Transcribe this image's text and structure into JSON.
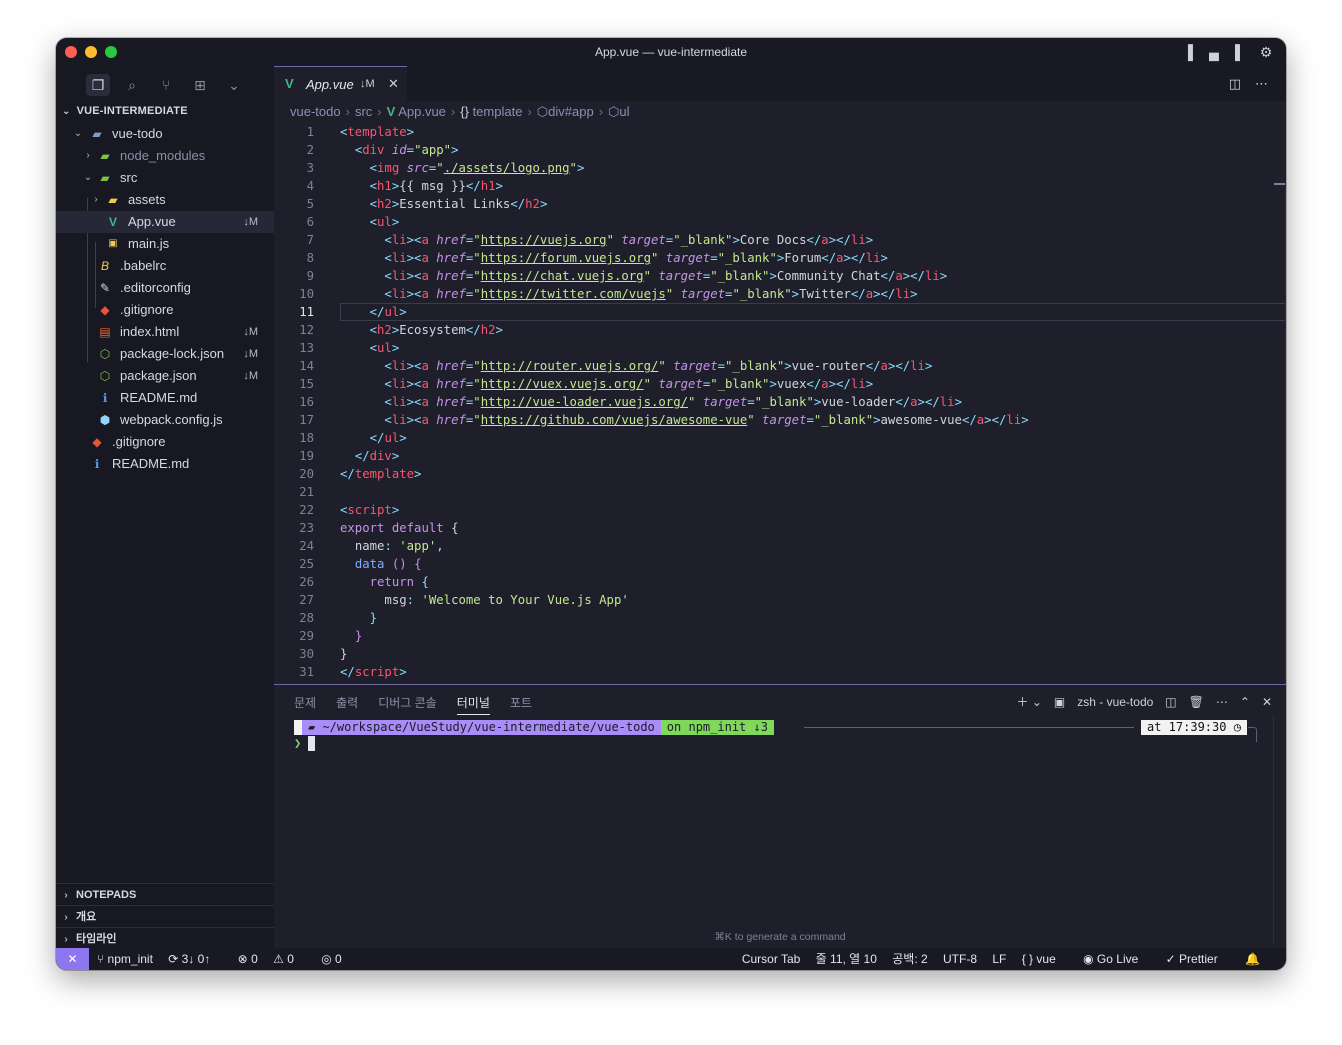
{
  "window": {
    "title": "App.vue — vue-intermediate"
  },
  "explorer": {
    "title": "VUE-INTERMEDIATE",
    "tree": [
      {
        "label": "vue-todo",
        "badge": ""
      },
      {
        "label": "node_modules",
        "badge": ""
      },
      {
        "label": "src",
        "badge": ""
      },
      {
        "label": "assets",
        "badge": ""
      },
      {
        "label": "App.vue",
        "badge": "↓M"
      },
      {
        "label": "main.js",
        "badge": ""
      },
      {
        "label": ".babelrc",
        "badge": ""
      },
      {
        "label": ".editorconfig",
        "badge": ""
      },
      {
        "label": ".gitignore",
        "badge": ""
      },
      {
        "label": "index.html",
        "badge": "↓M"
      },
      {
        "label": "package-lock.json",
        "badge": "↓M"
      },
      {
        "label": "package.json",
        "badge": "↓M"
      },
      {
        "label": "README.md",
        "badge": ""
      },
      {
        "label": "webpack.config.js",
        "badge": ""
      },
      {
        "label": ".gitignore",
        "badge": ""
      },
      {
        "label": "README.md",
        "badge": ""
      }
    ],
    "sections": [
      "NOTEPADS",
      "개요",
      "타임라인"
    ]
  },
  "editor": {
    "tab": {
      "name": "App.vue",
      "modified": "↓M",
      "close": "✕"
    },
    "breadcrumb": [
      "vue-todo",
      "src",
      "App.vue",
      "template",
      "div#app",
      "ul"
    ],
    "breadcrumb_glyphs": {
      "vue": "V",
      "template": "{}",
      "element": "⬡"
    },
    "current_line": 11,
    "lines": [
      "1",
      "2",
      "3",
      "4",
      "5",
      "6",
      "7",
      "8",
      "9",
      "10",
      "11",
      "12",
      "13",
      "14",
      "15",
      "16",
      "17",
      "18",
      "19",
      "20",
      "21",
      "22",
      "23",
      "24",
      "25",
      "26",
      "27",
      "28",
      "29",
      "30",
      "31"
    ],
    "code": {
      "template_tag": "template",
      "div_tag": "div",
      "img_tag": "img",
      "h1_tag": "h1",
      "h2_tag": "h2",
      "ul_tag": "ul",
      "li_tag": "li",
      "a_tag": "a",
      "script_tag": "script",
      "attr_id": "id",
      "attr_src": "src",
      "attr_href": "href",
      "attr_target": "target",
      "val_app": "\"app\"",
      "val_logo": "./assets/logo.png",
      "val_blank": "\"_blank\"",
      "mustache": "{{ msg }}",
      "h2_essential": "Essential Links",
      "h2_ecosystem": "Ecosystem",
      "links1": [
        {
          "href": "https://vuejs.org",
          "text": "Core Docs"
        },
        {
          "href": "https://forum.vuejs.org",
          "text": "Forum"
        },
        {
          "href": "https://chat.vuejs.org",
          "text": "Community Chat"
        },
        {
          "href": "https://twitter.com/vuejs",
          "text": "Twitter"
        }
      ],
      "links2": [
        {
          "href": "http://router.vuejs.org/",
          "text": "vue-router"
        },
        {
          "href": "http://vuex.vuejs.org/",
          "text": "vuex"
        },
        {
          "href": "http://vue-loader.vuejs.org/",
          "text": "vue-loader"
        },
        {
          "href": "https://github.com/vuejs/awesome-vue",
          "text": "awesome-vue"
        }
      ],
      "kw_export": "export",
      "kw_default": "default",
      "kw_return": "return",
      "prop_name": "name",
      "val_name": "'app'",
      "fn_data": "data",
      "prop_msg": "msg",
      "val_msg": "'Welcome to Your Vue.js App'"
    }
  },
  "panel": {
    "tabs": [
      "문제",
      "출력",
      "디버그 콘솔",
      "터미널",
      "포트"
    ],
    "active_tab": "터미널",
    "terminal_name": "zsh - vue-todo",
    "prompt": {
      "apple": "",
      "path": "~/workspace/VueStudy/vue-intermediate/vue-todo",
      "git": "on  npm_init ↓3",
      "time": "at 17:39:30 ◷",
      "caret": "❯"
    },
    "hint": "⌘K to generate a command"
  },
  "statusbar": {
    "branch": "npm_init",
    "sync": "3↓ 0↑",
    "errors": "0",
    "warnings": "0",
    "ports": "0",
    "cursor_tab": "Cursor Tab",
    "position": "줄 11, 열 10",
    "spaces": "공백: 2",
    "encoding": "UTF-8",
    "eol": "LF",
    "language": "vue",
    "golive": "Go Live",
    "prettier": "Prettier"
  },
  "colors": {
    "accent": "#8d76f0",
    "vue_green": "#41b883",
    "prompt_purple": "#a98cf7",
    "prompt_green": "#7fd85a"
  }
}
